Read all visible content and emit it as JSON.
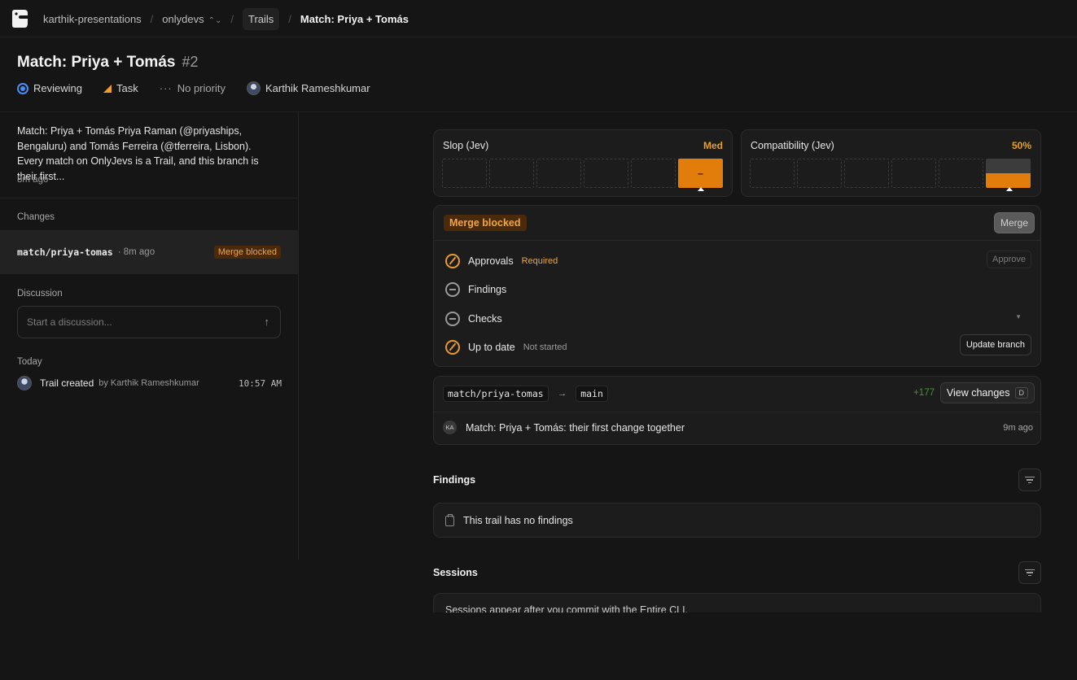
{
  "breadcrumb": {
    "org": "karthik-presentations",
    "project": "onlydevs",
    "section": "Trails",
    "current": "Match: Priya + Tomás"
  },
  "header": {
    "title": "Match: Priya + Tomás",
    "number": "#2",
    "status": "Reviewing",
    "type": "Task",
    "priority": "No priority",
    "assignee": "Karthik Rameshkumar"
  },
  "left": {
    "description": "Match: Priya + Tomás Priya Raman (@priyaships, Bengaluru) and Tomás Ferreira (@tferreira, Lisbon). Every match on OnlyJevs is a Trail, and this branch is their first...",
    "description_time": "8m ago",
    "changes_label": "Changes",
    "change": {
      "branch": "match/priya-tomas",
      "time": "· 8m ago",
      "badge": "Merge blocked"
    },
    "discussion_label": "Discussion",
    "discussion_placeholder": "Start a discussion...",
    "today_label": "Today",
    "timeline": {
      "title": "Trail created",
      "by": "by Karthik Rameshkumar",
      "time": "10:57 AM"
    }
  },
  "meters": {
    "slop": {
      "label": "Slop (Jev)",
      "value": "Med",
      "active_segment": 6,
      "active_symbol": "–"
    },
    "compat": {
      "label": "Compatibility (Jev)",
      "value": "50%",
      "fill_fraction": 0.5
    }
  },
  "merge": {
    "badge": "Merge blocked",
    "button": "Merge",
    "requirements": [
      {
        "label": "Approvals",
        "tag": "Required",
        "action": "Approve"
      },
      {
        "label": "Findings"
      },
      {
        "label": "Checks"
      },
      {
        "label": "Up to date",
        "tag": "Not started",
        "action": "Update branch"
      }
    ]
  },
  "branch": {
    "source": "match/priya-tomas",
    "arrow": "→",
    "target": "main",
    "additions": "+177",
    "view_button": "View changes",
    "view_shortcut": "D",
    "commit": {
      "initials": "KA",
      "message": "Match: Priya + Tomás: their first change together",
      "time": "9m ago"
    }
  },
  "findings": {
    "title": "Findings",
    "empty": "This trail has no findings"
  },
  "sessions": {
    "title": "Sessions",
    "empty": "Sessions appear after you commit with the Entire CLI."
  },
  "colors": {
    "accent_orange": "#e27c0a",
    "status_blue": "#4a8ef5",
    "additions_green": "#4f8f3a"
  }
}
